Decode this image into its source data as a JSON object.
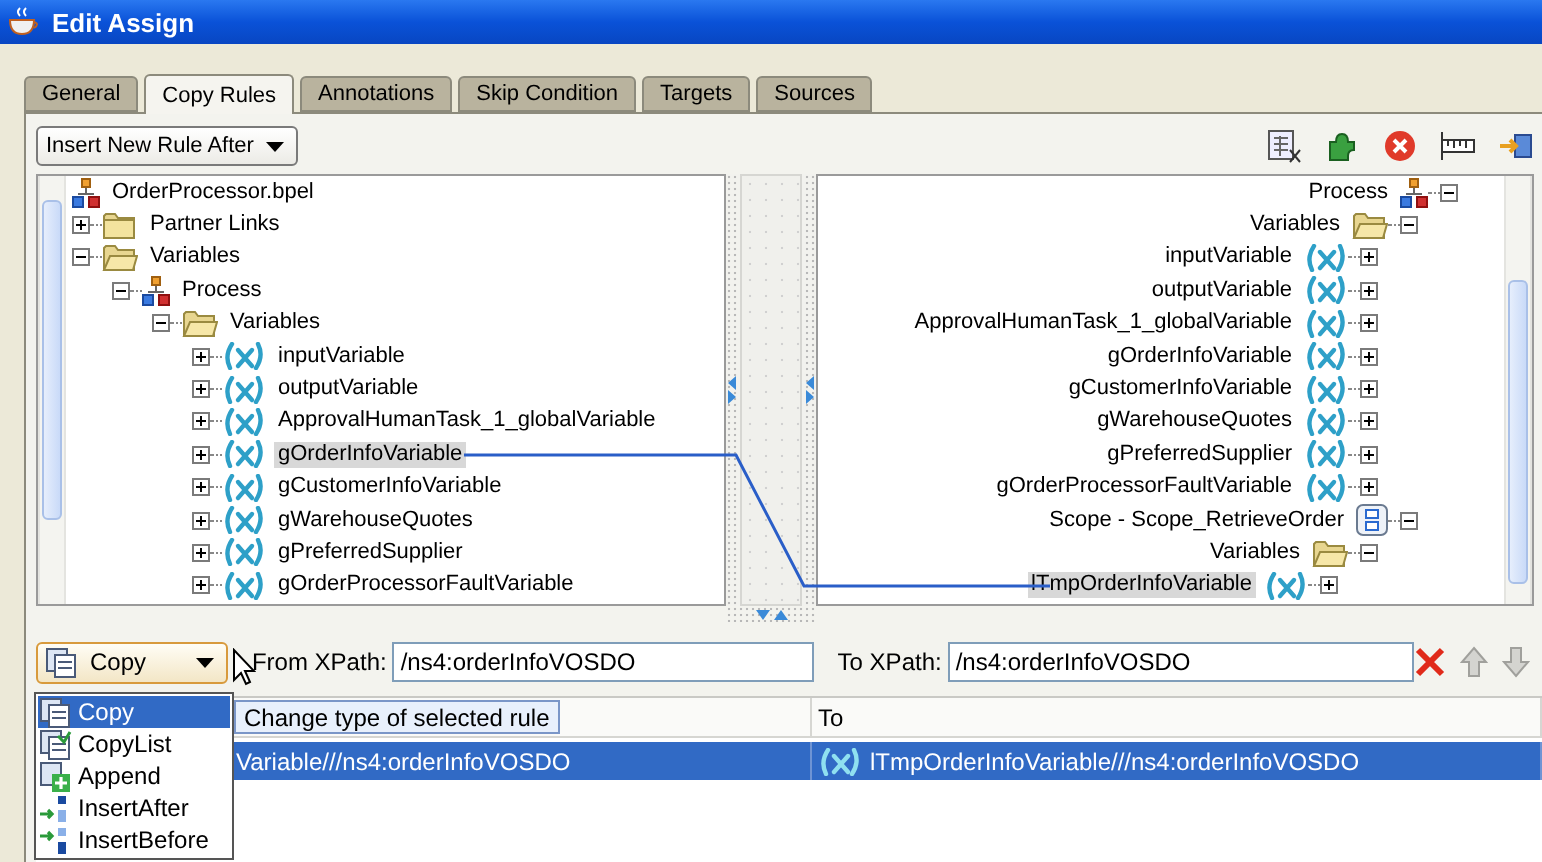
{
  "window": {
    "title": "Edit Assign"
  },
  "tabs": [
    {
      "label": "General",
      "selected": false
    },
    {
      "label": "Copy Rules",
      "selected": true
    },
    {
      "label": "Annotations",
      "selected": false
    },
    {
      "label": "Skip Condition",
      "selected": false
    },
    {
      "label": "Targets",
      "selected": false
    },
    {
      "label": "Sources",
      "selected": false
    }
  ],
  "insert_mode": {
    "value": "Insert New Rule After"
  },
  "source_tree": [
    {
      "label": "OrderProcessor.bpel",
      "kind": "bpel",
      "selected": false,
      "children": [
        {
          "label": "Partner Links",
          "kind": "folder",
          "expanded": false,
          "selected": false
        },
        {
          "label": "Variables",
          "kind": "folder",
          "expanded": true,
          "selected": false,
          "children": [
            {
              "label": "Process",
              "kind": "process",
              "expanded": true,
              "selected": false,
              "children": [
                {
                  "label": "Variables",
                  "kind": "folder",
                  "expanded": true,
                  "selected": false,
                  "children": [
                    {
                      "label": "inputVariable",
                      "kind": "variable",
                      "expanded": false,
                      "selected": false
                    },
                    {
                      "label": "outputVariable",
                      "kind": "variable",
                      "expanded": false,
                      "selected": false
                    },
                    {
                      "label": "ApprovalHumanTask_1_globalVariable",
                      "kind": "variable",
                      "expanded": false,
                      "selected": false
                    },
                    {
                      "label": "gOrderInfoVariable",
                      "kind": "variable",
                      "expanded": false,
                      "selected": true
                    },
                    {
                      "label": "gCustomerInfoVariable",
                      "kind": "variable",
                      "expanded": false,
                      "selected": false
                    },
                    {
                      "label": "gWarehouseQuotes",
                      "kind": "variable",
                      "expanded": false,
                      "selected": false
                    },
                    {
                      "label": "gPreferredSupplier",
                      "kind": "variable",
                      "expanded": false,
                      "selected": false
                    },
                    {
                      "label": "gOrderProcessorFaultVariable",
                      "kind": "variable",
                      "expanded": false,
                      "selected": false
                    }
                  ]
                }
              ]
            }
          ]
        }
      ]
    }
  ],
  "target_tree": [
    {
      "label": "Process",
      "kind": "process",
      "expanded": true,
      "selected": false,
      "children": [
        {
          "label": "Variables",
          "kind": "folder",
          "expanded": true,
          "selected": false,
          "children": [
            {
              "label": "inputVariable",
              "kind": "variable",
              "expanded": false,
              "selected": false
            },
            {
              "label": "outputVariable",
              "kind": "variable",
              "expanded": false,
              "selected": false
            },
            {
              "label": "ApprovalHumanTask_1_globalVariable",
              "kind": "variable",
              "expanded": false,
              "selected": false
            },
            {
              "label": "gOrderInfoVariable",
              "kind": "variable",
              "expanded": false,
              "selected": false
            },
            {
              "label": "gCustomerInfoVariable",
              "kind": "variable",
              "expanded": false,
              "selected": false
            },
            {
              "label": "gWarehouseQuotes",
              "kind": "variable",
              "expanded": false,
              "selected": false
            },
            {
              "label": "gPreferredSupplier",
              "kind": "variable",
              "expanded": false,
              "selected": false
            },
            {
              "label": "gOrderProcessorFaultVariable",
              "kind": "variable",
              "expanded": false,
              "selected": false
            }
          ]
        },
        {
          "label": "Scope - Scope_RetrieveOrder",
          "kind": "scope",
          "expanded": true,
          "selected": false,
          "children": [
            {
              "label": "Variables",
              "kind": "folder",
              "expanded": true,
              "selected": false,
              "children": [
                {
                  "label": "lTmpOrderInfoVariable",
                  "kind": "variable",
                  "expanded": false,
                  "selected": true
                }
              ]
            }
          ]
        }
      ]
    }
  ],
  "rule_editor": {
    "rule_type": "Copy",
    "from_label": "From XPath:",
    "from_value": "/ns4:orderInfoVOSDO",
    "to_label": "To XPath:",
    "to_value": "/ns4:orderInfoVOSDO"
  },
  "rules_table": {
    "to_header": "To",
    "rows": [
      {
        "from": "Variable///ns4:orderInfoVOSDO",
        "to": "lTmpOrderInfoVariable///ns4:orderInfoVOSDO",
        "selected": true
      }
    ]
  },
  "rule_type_menu": [
    {
      "label": "Copy",
      "kind": "copy",
      "selected": true
    },
    {
      "label": "CopyList",
      "kind": "copylist",
      "selected": false
    },
    {
      "label": "Append",
      "kind": "append",
      "selected": false
    },
    {
      "label": "InsertAfter",
      "kind": "insertafter",
      "selected": false
    },
    {
      "label": "InsertBefore",
      "kind": "insertbefore",
      "selected": false
    }
  ],
  "tooltip": "Change type of selected rule"
}
